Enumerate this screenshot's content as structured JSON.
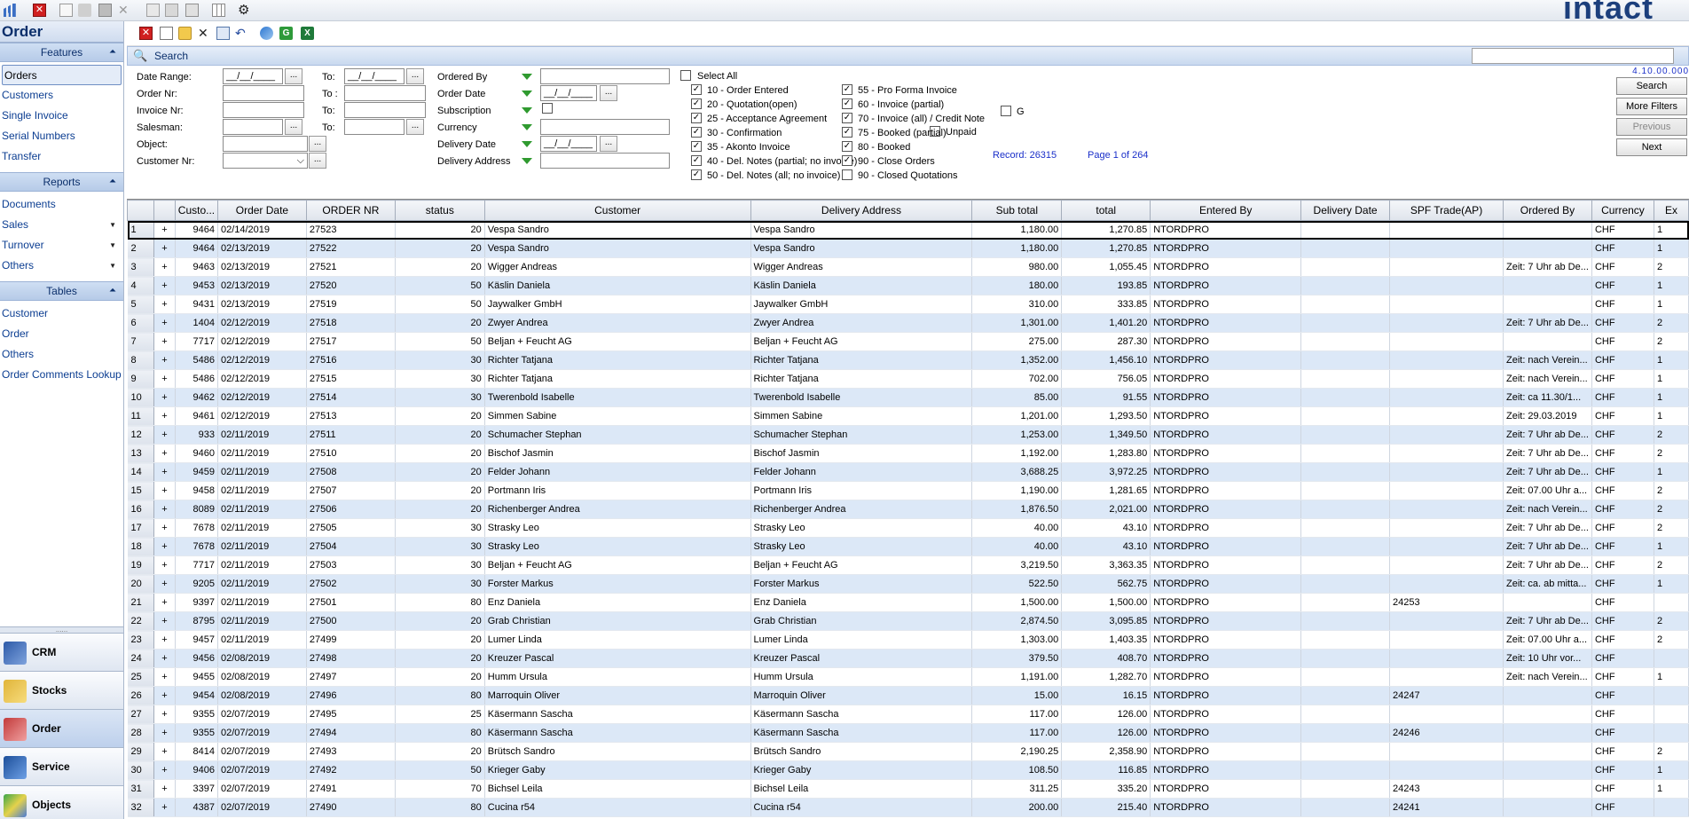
{
  "brand": "intact",
  "left": {
    "title": "Order",
    "features_header": "Features",
    "features": [
      "Orders",
      "Customers",
      "Single Invoice",
      "Serial Numbers",
      "Transfer"
    ],
    "reports_header": "Reports",
    "reports": [
      {
        "label": "Documents",
        "arrow": false
      },
      {
        "label": "Sales",
        "arrow": true
      },
      {
        "label": "Turnover",
        "arrow": true
      },
      {
        "label": "Others",
        "arrow": true
      }
    ],
    "tables_header": "Tables",
    "tables": [
      "Customer",
      "Order",
      "Others",
      "Order Comments Lookup"
    ],
    "modules": [
      "CRM",
      "Stocks",
      "Order",
      "Service",
      "Objects"
    ]
  },
  "search": {
    "label": "Search",
    "version": "4.10.00.000",
    "buttons": {
      "search": "Search",
      "more_filters": "More Filters",
      "previous": "Previous",
      "next": "Next"
    }
  },
  "filters": {
    "date_range": "Date Range:",
    "order_nr": "Order Nr:",
    "invoice_nr": "Invoice Nr:",
    "salesman": "Salesman:",
    "object": "Object:",
    "customer_nr": "Customer Nr:",
    "to1": "To:",
    "to2": "To :",
    "to3": "To:",
    "to4": "To:",
    "date_placeholder": "__/__/____",
    "ordered_by": "Ordered By",
    "order_date": "Order Date",
    "subscription": "Subscription",
    "currency": "Currency",
    "delivery_date": "Delivery Date",
    "delivery_address": "Delivery Address",
    "select_all": "Select All",
    "status_col1": [
      "10 - Order Entered",
      "20 - Quotation(open)",
      "25 - Acceptance Agreement",
      "30 - Confirmation",
      "35 - Akonto Invoice",
      "40 - Del. Notes (partial; no invoice)",
      "50 - Del. Notes (all; no invoice)"
    ],
    "status_col2": [
      "55 - Pro Forma Invoice",
      "60 - Invoice (partial)",
      "70 - Invoice (all) / Credit Note",
      "75 - Booked (partial)",
      "80 - Booked",
      "90 - Close Orders",
      "90 - Closed Quotations"
    ],
    "status_col2_checked": [
      true,
      true,
      true,
      true,
      true,
      true,
      false
    ],
    "g_label": "G",
    "unpaid_label": "Unpaid",
    "record": "Record:  26315",
    "page": "Page 1 of 264"
  },
  "grid": {
    "columns": [
      "",
      "",
      "Custo...",
      "Order Date",
      "ORDER NR",
      "status",
      "Customer",
      "Delivery Address",
      "Sub total",
      "total",
      "Entered By",
      "Delivery Date",
      "SPF Trade(AP)",
      "Ordered By",
      "Currency",
      "Ex"
    ],
    "rows": [
      [
        "1",
        "+",
        "9464",
        "02/14/2019",
        "27523",
        "20",
        "Vespa Sandro",
        "Vespa Sandro",
        "1,180.00",
        "1,270.85",
        "NTORDPRO",
        "",
        "",
        "",
        "CHF",
        "1"
      ],
      [
        "2",
        "+",
        "9464",
        "02/13/2019",
        "27522",
        "20",
        "Vespa Sandro",
        "Vespa Sandro",
        "1,180.00",
        "1,270.85",
        "NTORDPRO",
        "",
        "",
        "",
        "CHF",
        "1"
      ],
      [
        "3",
        "+",
        "9463",
        "02/13/2019",
        "27521",
        "20",
        "Wigger Andreas",
        "Wigger Andreas",
        "980.00",
        "1,055.45",
        "NTORDPRO",
        "",
        "",
        "Zeit: 7 Uhr ab De...",
        "CHF",
        "2"
      ],
      [
        "4",
        "+",
        "9453",
        "02/13/2019",
        "27520",
        "50",
        "Käslin Daniela",
        "Käslin Daniela",
        "180.00",
        "193.85",
        "NTORDPRO",
        "",
        "",
        "",
        "CHF",
        "1"
      ],
      [
        "5",
        "+",
        "9431",
        "02/13/2019",
        "27519",
        "50",
        "Jaywalker GmbH",
        "Jaywalker GmbH",
        "310.00",
        "333.85",
        "NTORDPRO",
        "",
        "",
        "",
        "CHF",
        "1"
      ],
      [
        "6",
        "+",
        "1404",
        "02/12/2019",
        "27518",
        "20",
        "Zwyer Andrea",
        "Zwyer Andrea",
        "1,301.00",
        "1,401.20",
        "NTORDPRO",
        "",
        "",
        "Zeit: 7 Uhr ab De...",
        "CHF",
        "2"
      ],
      [
        "7",
        "+",
        "7717",
        "02/12/2019",
        "27517",
        "50",
        "Beljan + Feucht AG",
        "Beljan + Feucht AG",
        "275.00",
        "287.30",
        "NTORDPRO",
        "",
        "",
        "",
        "CHF",
        "2"
      ],
      [
        "8",
        "+",
        "5486",
        "02/12/2019",
        "27516",
        "30",
        "Richter Tatjana",
        "Richter Tatjana",
        "1,352.00",
        "1,456.10",
        "NTORDPRO",
        "",
        "",
        "Zeit: nach Verein...",
        "CHF",
        "1"
      ],
      [
        "9",
        "+",
        "5486",
        "02/12/2019",
        "27515",
        "30",
        "Richter Tatjana",
        "Richter Tatjana",
        "702.00",
        "756.05",
        "NTORDPRO",
        "",
        "",
        "Zeit: nach Verein...",
        "CHF",
        "1"
      ],
      [
        "10",
        "+",
        "9462",
        "02/12/2019",
        "27514",
        "30",
        "Twerenbold Isabelle",
        "Twerenbold Isabelle",
        "85.00",
        "91.55",
        "NTORDPRO",
        "",
        "",
        "Zeit: ca  11.30/1...",
        "CHF",
        "1"
      ],
      [
        "11",
        "+",
        "9461",
        "02/12/2019",
        "27513",
        "20",
        "Simmen Sabine",
        "Simmen Sabine",
        "1,201.00",
        "1,293.50",
        "NTORDPRO",
        "",
        "",
        "Zeit: 29.03.2019",
        "CHF",
        "1"
      ],
      [
        "12",
        "+",
        "933",
        "02/11/2019",
        "27511",
        "20",
        "Schumacher Stephan",
        "Schumacher Stephan",
        "1,253.00",
        "1,349.50",
        "NTORDPRO",
        "",
        "",
        "Zeit: 7 Uhr ab De...",
        "CHF",
        "2"
      ],
      [
        "13",
        "+",
        "9460",
        "02/11/2019",
        "27510",
        "20",
        "Bischof Jasmin",
        "Bischof Jasmin",
        "1,192.00",
        "1,283.80",
        "NTORDPRO",
        "",
        "",
        "Zeit: 7 Uhr ab De...",
        "CHF",
        "2"
      ],
      [
        "14",
        "+",
        "9459",
        "02/11/2019",
        "27508",
        "20",
        "Felder Johann",
        "Felder Johann",
        "3,688.25",
        "3,972.25",
        "NTORDPRO",
        "",
        "",
        "Zeit: 7 Uhr ab De...",
        "CHF",
        "1"
      ],
      [
        "15",
        "+",
        "9458",
        "02/11/2019",
        "27507",
        "20",
        "Portmann Iris",
        "Portmann Iris",
        "1,190.00",
        "1,281.65",
        "NTORDPRO",
        "",
        "",
        "Zeit: 07.00 Uhr a...",
        "CHF",
        "2"
      ],
      [
        "16",
        "+",
        "8089",
        "02/11/2019",
        "27506",
        "20",
        "Richenberger Andrea",
        "Richenberger Andrea",
        "1,876.50",
        "2,021.00",
        "NTORDPRO",
        "",
        "",
        "Zeit: nach Verein...",
        "CHF",
        "2"
      ],
      [
        "17",
        "+",
        "7678",
        "02/11/2019",
        "27505",
        "30",
        "Strasky Leo",
        "Strasky Leo",
        "40.00",
        "43.10",
        "NTORDPRO",
        "",
        "",
        "Zeit: 7 Uhr ab De...",
        "CHF",
        "2"
      ],
      [
        "18",
        "+",
        "7678",
        "02/11/2019",
        "27504",
        "30",
        "Strasky Leo",
        "Strasky Leo",
        "40.00",
        "43.10",
        "NTORDPRO",
        "",
        "",
        "Zeit: 7 Uhr ab De...",
        "CHF",
        "1"
      ],
      [
        "19",
        "+",
        "7717",
        "02/11/2019",
        "27503",
        "30",
        "Beljan + Feucht AG",
        "Beljan + Feucht AG",
        "3,219.50",
        "3,363.35",
        "NTORDPRO",
        "",
        "",
        "Zeit: 7 Uhr ab De...",
        "CHF",
        "2"
      ],
      [
        "20",
        "+",
        "9205",
        "02/11/2019",
        "27502",
        "30",
        "Forster Markus",
        "Forster Markus",
        "522.50",
        "562.75",
        "NTORDPRO",
        "",
        "",
        "Zeit: ca. ab mitta...",
        "CHF",
        "1"
      ],
      [
        "21",
        "+",
        "9397",
        "02/11/2019",
        "27501",
        "80",
        "Enz Daniela",
        "Enz Daniela",
        "1,500.00",
        "1,500.00",
        "NTORDPRO",
        "",
        "24253",
        "",
        "CHF",
        ""
      ],
      [
        "22",
        "+",
        "8795",
        "02/11/2019",
        "27500",
        "20",
        "Grab Christian",
        "Grab Christian",
        "2,874.50",
        "3,095.85",
        "NTORDPRO",
        "",
        "",
        "Zeit: 7 Uhr ab De...",
        "CHF",
        "2"
      ],
      [
        "23",
        "+",
        "9457",
        "02/11/2019",
        "27499",
        "20",
        "Lumer Linda",
        "Lumer Linda",
        "1,303.00",
        "1,403.35",
        "NTORDPRO",
        "",
        "",
        "Zeit: 07.00 Uhr a...",
        "CHF",
        "2"
      ],
      [
        "24",
        "+",
        "9456",
        "02/08/2019",
        "27498",
        "20",
        "Kreuzer Pascal",
        "Kreuzer Pascal",
        "379.50",
        "408.70",
        "NTORDPRO",
        "",
        "",
        "Zeit: 10 Uhr vor...",
        "CHF",
        ""
      ],
      [
        "25",
        "+",
        "9455",
        "02/08/2019",
        "27497",
        "20",
        "Humm Ursula",
        "Humm Ursula",
        "1,191.00",
        "1,282.70",
        "NTORDPRO",
        "",
        "",
        "Zeit: nach Verein...",
        "CHF",
        "1"
      ],
      [
        "26",
        "+",
        "9454",
        "02/08/2019",
        "27496",
        "80",
        "Marroquin Oliver",
        "Marroquin Oliver",
        "15.00",
        "16.15",
        "NTORDPRO",
        "",
        "24247",
        "",
        "CHF",
        ""
      ],
      [
        "27",
        "+",
        "9355",
        "02/07/2019",
        "27495",
        "25",
        "Käsermann Sascha",
        "Käsermann Sascha",
        "117.00",
        "126.00",
        "NTORDPRO",
        "",
        "",
        "",
        "CHF",
        ""
      ],
      [
        "28",
        "+",
        "9355",
        "02/07/2019",
        "27494",
        "80",
        "Käsermann Sascha",
        "Käsermann Sascha",
        "117.00",
        "126.00",
        "NTORDPRO",
        "",
        "24246",
        "",
        "CHF",
        ""
      ],
      [
        "29",
        "+",
        "8414",
        "02/07/2019",
        "27493",
        "20",
        "Brütsch Sandro",
        "Brütsch Sandro",
        "2,190.25",
        "2,358.90",
        "NTORDPRO",
        "",
        "",
        "",
        "CHF",
        "2"
      ],
      [
        "30",
        "+",
        "9406",
        "02/07/2019",
        "27492",
        "50",
        "Krieger Gaby",
        "Krieger Gaby",
        "108.50",
        "116.85",
        "NTORDPRO",
        "",
        "",
        "",
        "CHF",
        "1"
      ],
      [
        "31",
        "+",
        "3397",
        "02/07/2019",
        "27491",
        "70",
        "Bichsel Leila",
        "Bichsel Leila",
        "311.25",
        "335.20",
        "NTORDPRO",
        "",
        "24243",
        "",
        "CHF",
        "1"
      ],
      [
        "32",
        "+",
        "4387",
        "02/07/2019",
        "27490",
        "80",
        "Cucina r54",
        "Cucina r54",
        "200.00",
        "215.40",
        "NTORDPRO",
        "",
        "24241",
        "",
        "CHF",
        ""
      ]
    ]
  }
}
